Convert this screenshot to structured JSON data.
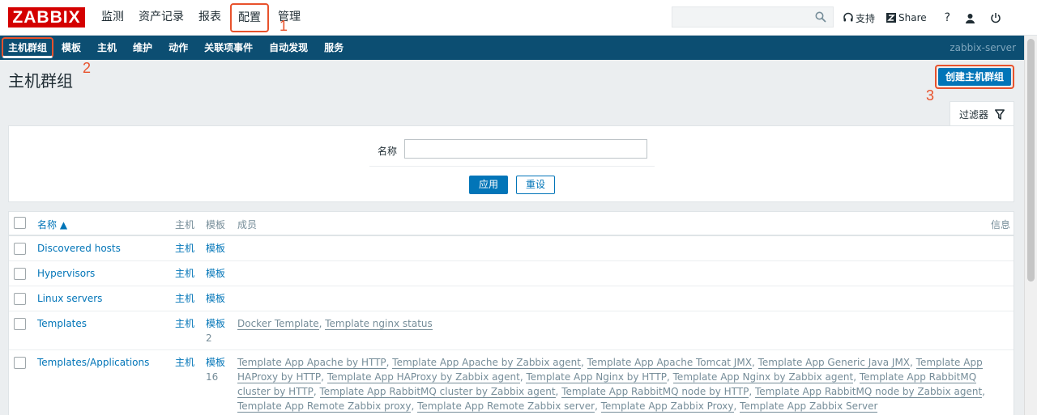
{
  "logo": "ZABBIX",
  "main_menu": [
    {
      "label": "监测",
      "active": false
    },
    {
      "label": "资产记录",
      "active": false
    },
    {
      "label": "报表",
      "active": false
    },
    {
      "label": "配置",
      "active": true
    },
    {
      "label": "管理",
      "active": false
    }
  ],
  "search": {
    "placeholder": "",
    "value": ""
  },
  "top_links": {
    "support": "支持",
    "share": "Share",
    "help": "?"
  },
  "sub_menu": [
    {
      "label": "主机群组",
      "active": true
    },
    {
      "label": "模板",
      "active": false
    },
    {
      "label": "主机",
      "active": false
    },
    {
      "label": "维护",
      "active": false
    },
    {
      "label": "动作",
      "active": false
    },
    {
      "label": "关联项事件",
      "active": false
    },
    {
      "label": "自动发现",
      "active": false
    },
    {
      "label": "服务",
      "active": false
    }
  ],
  "server_name": "zabbix-server",
  "annotations": [
    "1",
    "2",
    "3"
  ],
  "page_title": "主机群组",
  "create_button": "创建主机群组",
  "filter": {
    "tab_label": "过滤器",
    "name_label": "名称",
    "name_value": "",
    "apply_label": "应用",
    "reset_label": "重设"
  },
  "table": {
    "headers": {
      "name": "名称 ▲",
      "hosts": "主机",
      "templates": "模板",
      "members": "成员",
      "info": "信息"
    },
    "rows": [
      {
        "name": "Discovered hosts",
        "hosts": "主机",
        "templates": "模板",
        "templates_count": "",
        "members": []
      },
      {
        "name": "Hypervisors",
        "hosts": "主机",
        "templates": "模板",
        "templates_count": "",
        "members": []
      },
      {
        "name": "Linux servers",
        "hosts": "主机",
        "templates": "模板",
        "templates_count": "",
        "members": []
      },
      {
        "name": "Templates",
        "hosts": "主机",
        "templates": "模板",
        "templates_count": "2",
        "members": [
          "Docker Template",
          "Template nginx status"
        ]
      },
      {
        "name": "Templates/Applications",
        "hosts": "主机",
        "templates": "模板",
        "templates_count": "16",
        "members": [
          "Template App Apache by HTTP",
          "Template App Apache by Zabbix agent",
          "Template App Apache Tomcat JMX",
          "Template App Generic Java JMX",
          "Template App HAProxy by HTTP",
          "Template App HAProxy by Zabbix agent",
          "Template App Nginx by HTTP",
          "Template App Nginx by Zabbix agent",
          "Template App RabbitMQ cluster by HTTP",
          "Template App RabbitMQ cluster by Zabbix agent",
          "Template App RabbitMQ node by HTTP",
          "Template App RabbitMQ node by Zabbix agent",
          "Template App Remote Zabbix proxy",
          "Template App Remote Zabbix server",
          "Template App Zabbix Proxy",
          "Template App Zabbix Server"
        ]
      }
    ]
  },
  "colors": {
    "brand": "#d40000",
    "nav": "#0c4e72",
    "link": "#0275b8",
    "highlight": "#e8522c"
  }
}
